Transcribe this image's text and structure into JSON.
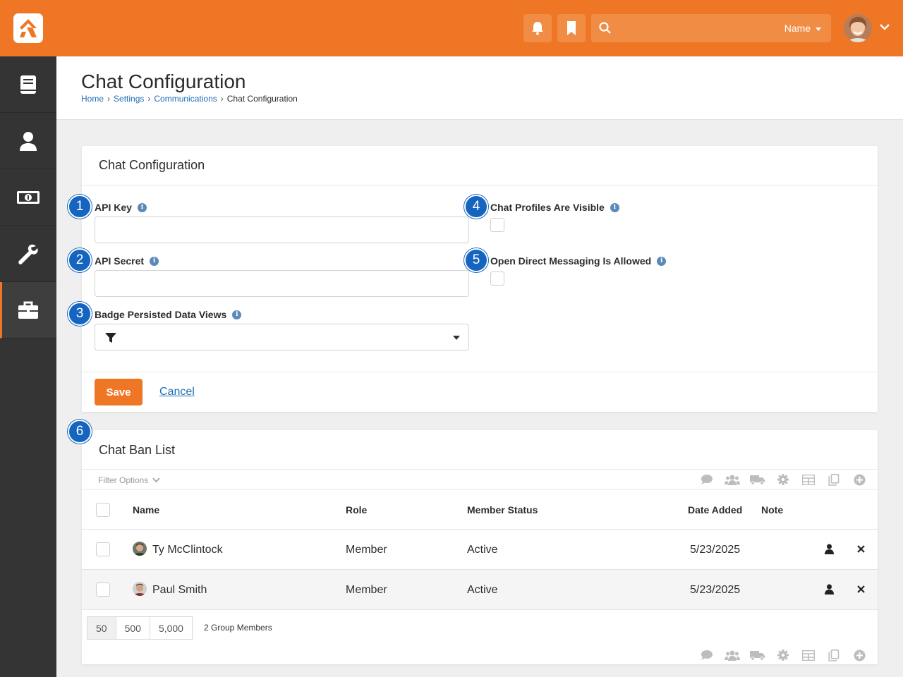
{
  "topbar": {
    "search_placeholder": "",
    "search_scope": "Name",
    "accent": "#ee7624"
  },
  "sidebar": {
    "items": [
      {
        "icon": "book-icon"
      },
      {
        "icon": "person-icon"
      },
      {
        "icon": "money-icon"
      },
      {
        "icon": "wrench-icon"
      },
      {
        "icon": "briefcase-icon",
        "active": true
      }
    ]
  },
  "header": {
    "title": "Chat Configuration",
    "breadcrumb": [
      "Home",
      "Settings",
      "Communications",
      "Chat Configuration"
    ]
  },
  "config_panel": {
    "title": "Chat Configuration",
    "fields": {
      "api_key": {
        "label": "API Key",
        "value": ""
      },
      "api_secret": {
        "label": "API Secret",
        "value": ""
      },
      "badge_views": {
        "label": "Badge Persisted Data Views",
        "value": ""
      },
      "profiles_visible": {
        "label": "Chat Profiles Are Visible",
        "checked": false
      },
      "direct_messaging": {
        "label": "Open Direct Messaging Is Allowed",
        "checked": false
      }
    },
    "save_label": "Save",
    "cancel_label": "Cancel"
  },
  "badges": [
    "1",
    "2",
    "3",
    "4",
    "5",
    "6"
  ],
  "ban_list": {
    "title": "Chat Ban List",
    "filter_label": "Filter Options",
    "columns": [
      "Name",
      "Role",
      "Member Status",
      "Date Added",
      "Note"
    ],
    "rows": [
      {
        "name": "Ty McClintock",
        "role": "Member",
        "status": "Active",
        "date_added": "5/23/2025",
        "note": ""
      },
      {
        "name": "Paul Smith",
        "role": "Member",
        "status": "Active",
        "date_added": "5/23/2025",
        "note": ""
      }
    ],
    "page_sizes": [
      "50",
      "500",
      "5,000"
    ],
    "count_text": "2 Group Members"
  }
}
